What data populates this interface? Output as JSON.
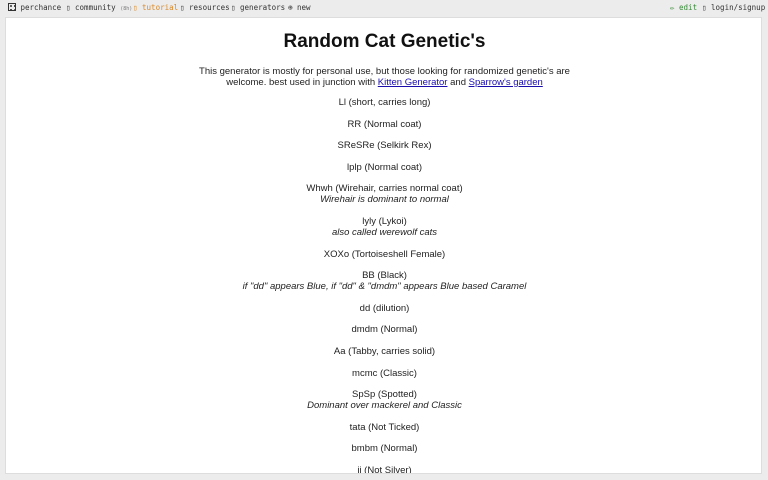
{
  "nav": {
    "site": "perchance",
    "community": "community",
    "community_count": "(8h)",
    "tutorial": "tutorial",
    "resources": "resources",
    "generators": "generators",
    "new": "new",
    "edit": "edit",
    "login": "login/signup"
  },
  "page": {
    "title": "Random Cat Genetic's",
    "intro_line1": "This generator is mostly for personal use, but those looking for randomized genetic's are",
    "intro_line2_prefix": "welcome. best used in junction with",
    "link1": "Kitten Generator",
    "and": "and",
    "link2": "Sparrow's garden"
  },
  "genes": [
    {
      "text": "Ll (short, carries long)",
      "note": ""
    },
    {
      "text": "RR (Normal coat)",
      "note": ""
    },
    {
      "text": "SReSRe (Selkirk Rex)",
      "note": ""
    },
    {
      "text": "lplp (Normal coat)",
      "note": ""
    },
    {
      "text": "Whwh (Wirehair, carries normal coat)",
      "note": "Wirehair is dominant to normal"
    },
    {
      "text": "lyly (Lykoi)",
      "note": "also called werewolf cats"
    },
    {
      "text": "XOXo (Tortoiseshell Female)",
      "note": ""
    },
    {
      "text": "BB (Black)",
      "note": "if \"dd\" appears Blue, if \"dd\" & \"dmdm\" appears Blue based Caramel"
    },
    {
      "text": "dd (dilution)",
      "note": ""
    },
    {
      "text": "dmdm (Normal)",
      "note": ""
    },
    {
      "text": "Aa (Tabby, carries solid)",
      "note": ""
    },
    {
      "text": "mcmc (Classic)",
      "note": ""
    },
    {
      "text": "SpSp (Spotted)",
      "note": "Dominant over mackerel and Classic"
    },
    {
      "text": "tata (Not Ticked)",
      "note": ""
    },
    {
      "text": "bmbm (Normal)",
      "note": ""
    },
    {
      "text": "ii (Not Silver)",
      "note": ""
    }
  ]
}
